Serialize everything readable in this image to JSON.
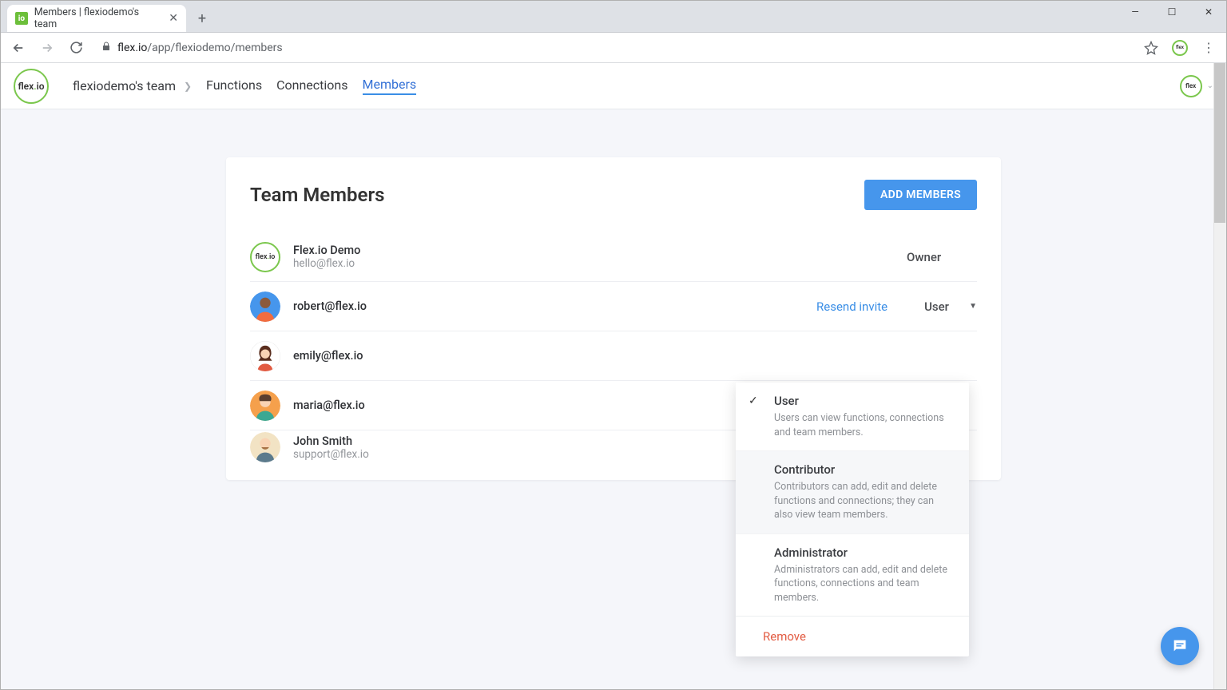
{
  "browser": {
    "tab_title": "Members | flexiodemo's team",
    "url_host": "flex.io",
    "url_path": "/app/flexiodemo/members"
  },
  "header": {
    "breadcrumb": "flexiodemo's team",
    "nav": {
      "functions": "Functions",
      "connections": "Connections",
      "members": "Members"
    }
  },
  "page": {
    "title": "Team Members",
    "add_btn": "ADD MEMBERS"
  },
  "members": [
    {
      "name": "Flex.io Demo",
      "email": "hello@flex.io",
      "role": "Owner",
      "resend": "",
      "avatar": "flexio"
    },
    {
      "name": "",
      "email": "robert@flex.io",
      "role": "User",
      "resend": "Resend invite",
      "avatar": "m1",
      "dropdown": true
    },
    {
      "name": "",
      "email": "emily@flex.io",
      "role": "",
      "resend": "",
      "avatar": "f1"
    },
    {
      "name": "",
      "email": "maria@flex.io",
      "role": "",
      "resend": "",
      "avatar": "f2"
    },
    {
      "name": "John Smith",
      "email": "support@flex.io",
      "role": "",
      "resend": "",
      "avatar": "m2"
    }
  ],
  "dropdown": {
    "user": {
      "title": "User",
      "desc": "Users can view functions, connections and team members."
    },
    "contributor": {
      "title": "Contributor",
      "desc": "Contributors can add, edit and delete functions and connections; they can also view team members."
    },
    "admin": {
      "title": "Administrator",
      "desc": "Administrators can add, edit and delete functions, connections and team members."
    },
    "remove": "Remove"
  }
}
